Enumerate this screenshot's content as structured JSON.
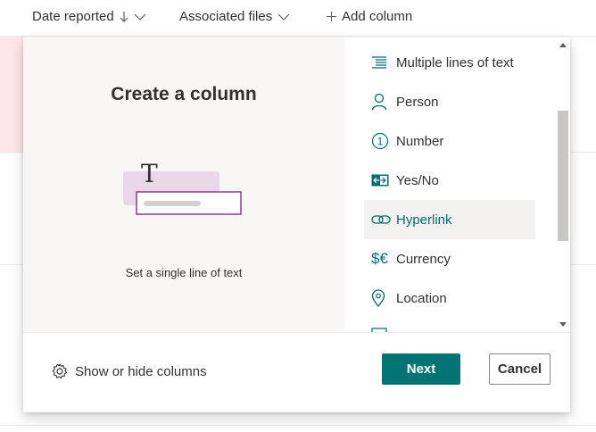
{
  "list_header": {
    "date_reported": "Date reported",
    "associated_files": "Associated files",
    "add_column": "Add column"
  },
  "panel": {
    "title": "Create a column",
    "preview_description": "Set a single line of text",
    "preview_glyph": "T",
    "column_types": [
      {
        "label": "Multiple lines of text",
        "icon": "multiline-text-icon"
      },
      {
        "label": "Person",
        "icon": "person-icon"
      },
      {
        "label": "Number",
        "icon": "number-icon",
        "icon_text": "1"
      },
      {
        "label": "Yes/No",
        "icon": "yes-no-icon"
      },
      {
        "label": "Hyperlink",
        "icon": "link-icon",
        "selected": true
      },
      {
        "label": "Currency",
        "icon": "currency-icon",
        "icon_text": "$€"
      },
      {
        "label": "Location",
        "icon": "location-pin-icon"
      }
    ],
    "footer": {
      "show_hide": "Show or hide columns",
      "next": "Next",
      "cancel": "Cancel"
    }
  },
  "colors": {
    "accent": "#037473",
    "accent_text": "#036c70",
    "preview_bg": "#f8f7f6",
    "illus_block": "#e8d7e6",
    "illus_border": "#8e3a8a"
  }
}
